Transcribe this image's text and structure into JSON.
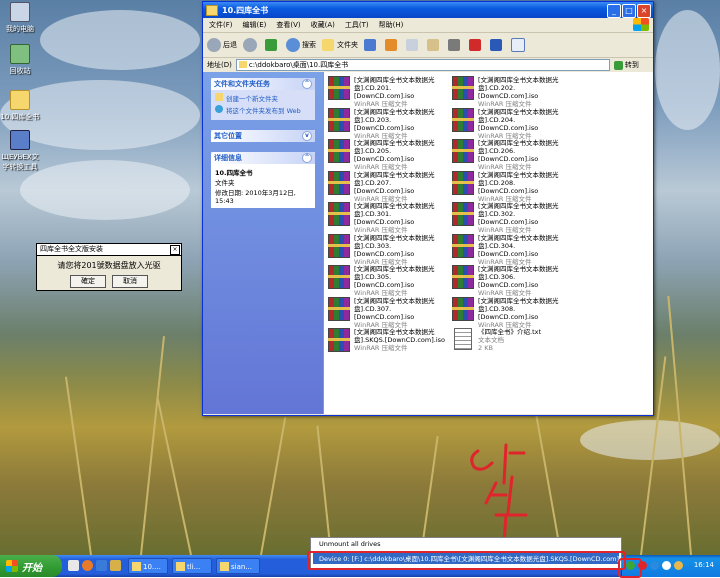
{
  "desktop": {
    "icons": [
      {
        "label": "我的电脑"
      },
      {
        "label": "回收站"
      },
      {
        "label": "10.四库全书"
      },
      {
        "label": "ЩЕУЬЕХ文字转换工具"
      }
    ]
  },
  "window": {
    "title": "10.四库全书",
    "menu": [
      "文件(F)",
      "编辑(E)",
      "查看(V)",
      "收藏(A)",
      "工具(T)",
      "帮助(H)"
    ],
    "toolbar": {
      "back": "后退",
      "search": "搜索",
      "folders": "文件夹"
    },
    "address": {
      "label": "地址(D)",
      "value": "c:\\ddokbaro\\桌面\\10.四库全书",
      "go": "转到"
    },
    "tasks": {
      "title": "文件和文件夹任务",
      "items": [
        "创建一个新文件夹",
        "将这个文件夹发布到 Web"
      ]
    },
    "other_places": {
      "title": "其它位置"
    },
    "details": {
      "title": "详细信息",
      "name": "10.四库全书",
      "type": "文件夹",
      "modified": "修改日期: 2010年3月12日, 15:43"
    },
    "files": [
      {
        "line1": "[文渊阁四库全书文本数据光",
        "line2": "盘].CD.201.[DownCD.com].iso",
        "type": "WinRAR 压缩文件"
      },
      {
        "line1": "[文渊阁四库全书文本数据光",
        "line2": "盘].CD.202.[DownCD.com].iso",
        "type": "WinRAR 压缩文件"
      },
      {
        "line1": "[文渊阁四库全书文本数据光",
        "line2": "盘].CD.203.[DownCD.com].iso",
        "type": "WinRAR 压缩文件"
      },
      {
        "line1": "[文渊阁四库全书文本数据光",
        "line2": "盘].CD.204.[DownCD.com].iso",
        "type": "WinRAR 压缩文件"
      },
      {
        "line1": "[文渊阁四库全书文本数据光",
        "line2": "盘].CD.205.[DownCD.com].iso",
        "type": "WinRAR 压缩文件"
      },
      {
        "line1": "[文渊阁四库全书文本数据光",
        "line2": "盘].CD.206.[DownCD.com].iso",
        "type": "WinRAR 压缩文件"
      },
      {
        "line1": "[文渊阁四库全书文本数据光",
        "line2": "盘].CD.207.[DownCD.com].iso",
        "type": "WinRAR 压缩文件"
      },
      {
        "line1": "[文渊阁四库全书文本数据光",
        "line2": "盘].CD.208.[DownCD.com].iso",
        "type": "WinRAR 压缩文件"
      },
      {
        "line1": "[文渊阁四库全书文本数据光",
        "line2": "盘].CD.301.[DownCD.com].iso",
        "type": "WinRAR 压缩文件"
      },
      {
        "line1": "[文渊阁四库全书文本数据光",
        "line2": "盘].CD.302.[DownCD.com].iso",
        "type": "WinRAR 压缩文件"
      },
      {
        "line1": "[文渊阁四库全书文本数据光",
        "line2": "盘].CD.303.[DownCD.com].iso",
        "type": "WinRAR 压缩文件"
      },
      {
        "line1": "[文渊阁四库全书文本数据光",
        "line2": "盘].CD.304.[DownCD.com].iso",
        "type": "WinRAR 压缩文件"
      },
      {
        "line1": "[文渊阁四库全书文本数据光",
        "line2": "盘].CD.305.[DownCD.com].iso",
        "type": "WinRAR 压缩文件"
      },
      {
        "line1": "[文渊阁四库全书文本数据光",
        "line2": "盘].CD.306.[DownCD.com].iso",
        "type": "WinRAR 压缩文件"
      },
      {
        "line1": "[文渊阁四库全书文本数据光",
        "line2": "盘].CD.307.[DownCD.com].iso",
        "type": "WinRAR 压缩文件"
      },
      {
        "line1": "[文渊阁四库全书文本数据光",
        "line2": "盘].CD.308.[DownCD.com].iso",
        "type": "WinRAR 压缩文件"
      },
      {
        "line1": "[文渊阁四库全书文本数据光",
        "line2": "盘].SKQS.[DownCD.com].iso",
        "type": "WinRAR 压缩文件"
      },
      {
        "line1": "《四库全书》介绍.txt",
        "line2": "文本文档",
        "type": "2 KB",
        "icon": "text-file-icon"
      }
    ]
  },
  "dialog": {
    "title": "四库全书全文版安装",
    "message": "请您将201號数据盘放入光驱",
    "ok": "確定",
    "cancel": "取消"
  },
  "taskbar": {
    "start": "开始",
    "tasks": [
      "10....",
      "tli...",
      "sian..."
    ],
    "clock": "16:14"
  },
  "popup": {
    "unmount": "Unmount all drives",
    "device": "Device 0: [F:] c:\\ddokbaro\\桌面\\10.四库全书\\[文渊阁四库全书文本数据光盘].SKQS.[DownCD.com].iso"
  },
  "colors": {
    "annotation": "#e0242b",
    "titlebar": "#0a5ae0",
    "selection": "#316ac5"
  }
}
